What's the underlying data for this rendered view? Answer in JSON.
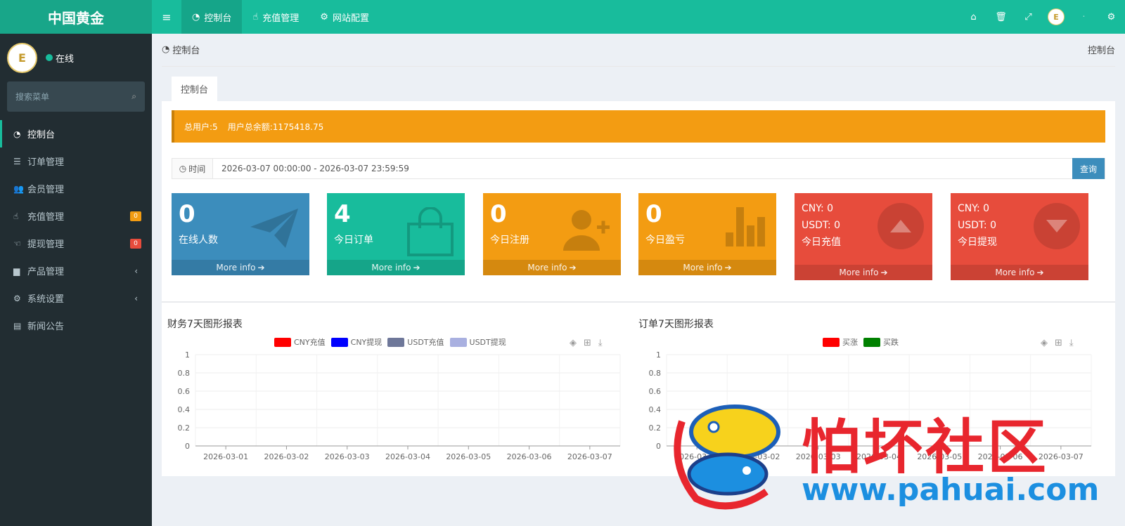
{
  "brand": {
    "title": "中国黄金",
    "logo_text": "E"
  },
  "topnav": {
    "tabs": [
      {
        "label": "控制台",
        "icon": "dashboard-icon"
      },
      {
        "label": "充值管理",
        "icon": "hand-pointer-icon"
      },
      {
        "label": "网站配置",
        "icon": "gear-icon"
      }
    ]
  },
  "user": {
    "status": "在线",
    "name": ""
  },
  "search": {
    "placeholder": "搜索菜单"
  },
  "menu": {
    "items": [
      {
        "label": "控制台"
      },
      {
        "label": "订单管理"
      },
      {
        "label": "会员管理"
      },
      {
        "label": "充值管理",
        "badge": "0"
      },
      {
        "label": "提现管理",
        "badge": "0"
      },
      {
        "label": "产品管理"
      },
      {
        "label": "系统设置"
      },
      {
        "label": "新闻公告"
      }
    ]
  },
  "breadcrumb": {
    "left": "控制台",
    "right": "控制台"
  },
  "panel": {
    "tab": "控制台"
  },
  "alert": {
    "users": "总用户:5",
    "balance": "用户总余额:1175418.75"
  },
  "date_filter": {
    "label": "时间",
    "range": "2026-03-07 00:00:00 - 2026-03-07 23:59:59",
    "button": "查询"
  },
  "stats": {
    "online": {
      "value": "0",
      "label": "在线人数",
      "more": "More info"
    },
    "orders": {
      "value": "4",
      "label": "今日订单",
      "more": "More info"
    },
    "register": {
      "value": "0",
      "label": "今日注册",
      "more": "More info"
    },
    "profit": {
      "value": "0",
      "label": "今日盈亏",
      "more": "More info"
    },
    "recharge": {
      "cny": "CNY:  0",
      "usdt": "USDT:  0",
      "label": "今日充值",
      "more": "More info"
    },
    "withdraw": {
      "cny": "CNY:  0",
      "usdt": "USDT:  0",
      "label": "今日提现",
      "more": "More info"
    }
  },
  "colors": {
    "blue": "#3c8dbc",
    "green": "#18bc9c",
    "orange": "#f39c12",
    "red": "#e74c3c",
    "sidebar": "#222d32"
  },
  "watermark": {
    "text": "怕坏社区",
    "url": "www.pahuai.com"
  },
  "chart_data": [
    {
      "type": "line",
      "title": "财务7天图形报表",
      "categories": [
        "2026-03-01",
        "2026-03-02",
        "2026-03-03",
        "2026-03-04",
        "2026-03-05",
        "2026-03-06",
        "2026-03-07"
      ],
      "series": [
        {
          "name": "CNY充值",
          "color": "#ff0000",
          "values": []
        },
        {
          "name": "CNY提现",
          "color": "#0000ff",
          "values": []
        },
        {
          "name": "USDT充值",
          "color": "#6e7799",
          "values": []
        },
        {
          "name": "USDT提现",
          "color": "#a9b0e0",
          "values": []
        }
      ],
      "yticks": [
        "0",
        "0.2",
        "0.4",
        "0.6",
        "0.8",
        "1"
      ],
      "ylim": [
        0,
        1
      ],
      "grid": true,
      "legend": "top-center"
    },
    {
      "type": "line",
      "title": "订单7天图形报表",
      "categories": [
        "2026-03-01",
        "2026-03-02",
        "2026-03-03",
        "2026-03-04",
        "2026-03-05",
        "2026-03-06",
        "2026-03-07"
      ],
      "series": [
        {
          "name": "买涨",
          "color": "#ff0000",
          "values": []
        },
        {
          "name": "买跌",
          "color": "#008000",
          "values": []
        }
      ],
      "yticks": [
        "0",
        "0.2",
        "0.4",
        "0.6",
        "0.8",
        "1"
      ],
      "ylim": [
        0,
        1
      ],
      "grid": true,
      "legend": "top-center"
    }
  ]
}
